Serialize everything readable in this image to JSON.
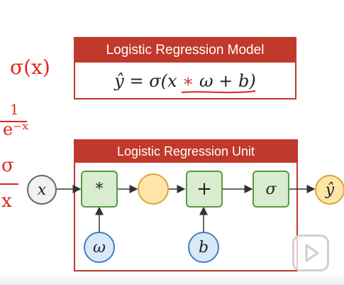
{
  "model": {
    "title": "Logistic Regression Model",
    "formula_html": "y&#770; = &sigma;(x &lowast; &omega; + b)"
  },
  "unit": {
    "title": "Logistic Regression Unit",
    "nodes": {
      "x": "x",
      "mul": "*",
      "add": "+",
      "sigma": "σ",
      "y": "ŷ",
      "omega": "ω",
      "b": "b"
    }
  },
  "annotations": {
    "sigma_x": "σ(x)",
    "frac_top": "1",
    "frac_bottom": "e⁻ˣ",
    "frac2_top": "σ",
    "frac2_bottom": "x"
  },
  "colors": {
    "accent": "#c0392b",
    "ink_red": "#e0261b",
    "green_fill": "#d9ecd0",
    "green_border": "#5a9a42",
    "blue_fill": "#d9e8f7",
    "blue_border": "#3f7fc1",
    "yellow_fill": "#ffe6a8",
    "yellow_border": "#d9a53a",
    "gray_fill": "#f2f2f2"
  },
  "icons": [
    "play-icon"
  ]
}
